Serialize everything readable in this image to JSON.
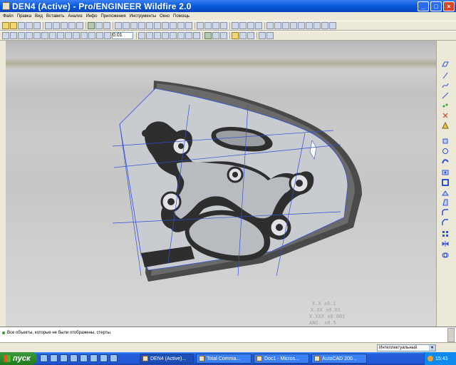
{
  "window": {
    "title": "DEN4 (Active) - Pro/ENGINEER Wildfire 2.0"
  },
  "menu": {
    "items": [
      "Файл",
      "Правка",
      "Вид",
      "Вставить",
      "Анализ",
      "Инфо",
      "Приложения",
      "Инструменты",
      "Окно",
      "Помощь"
    ]
  },
  "toolbar": {
    "precision_label": "0.01"
  },
  "viewport": {
    "tolerance_lines": [
      "X.X   ±0.1",
      "X.XX   ±0.01",
      "X.XXX ±0.001",
      "ANG.   ±0.5"
    ]
  },
  "message_area": {
    "message": "Все объекты, которые не были отображены, стерты."
  },
  "status_bar": {
    "filter_value": "Интеллектуальный"
  },
  "taskbar": {
    "start_label": "пуск",
    "tasks": [
      "DEN4 (Active)...",
      "Total Comma...",
      "Doc1 - Micros...",
      "AutoCAD 200..."
    ],
    "clock": "15:43"
  },
  "colors": {
    "titlebar": "#0a58d8",
    "viewport_bg": "#c0c0c0",
    "part_face": "#c8cbd0",
    "part_wall": "#4a4a4a",
    "datum_lines": "#3050d8"
  }
}
